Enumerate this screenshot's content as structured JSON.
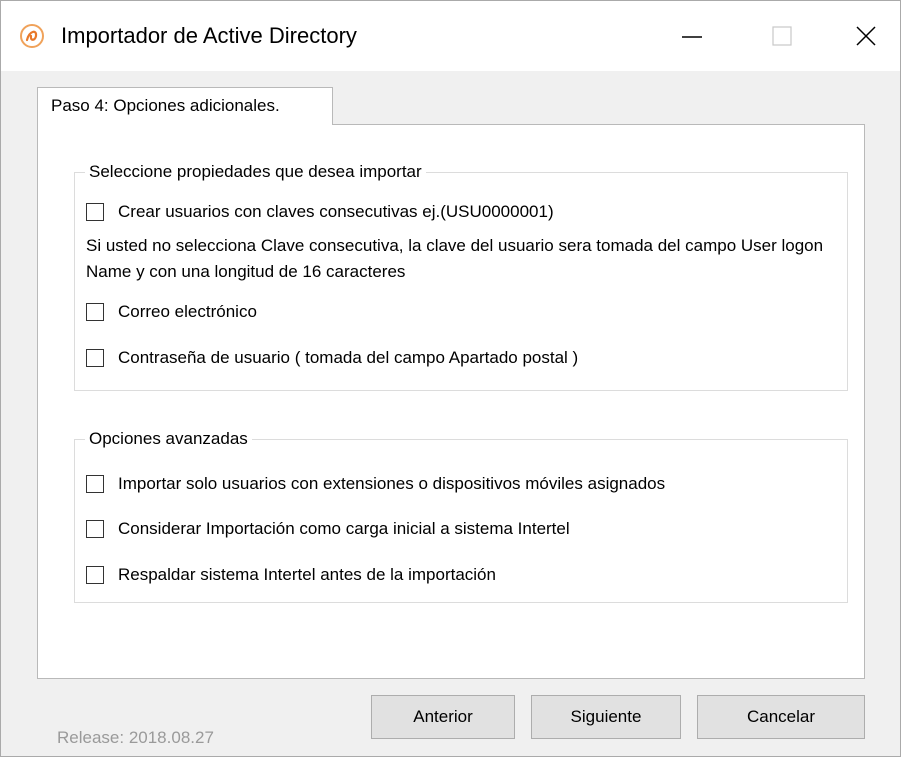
{
  "window": {
    "title": "Importador de Active Directory",
    "icon": "orange-swirl-app-icon",
    "controls": {
      "minimize_icon": "minimize-icon",
      "maximize_icon": "maximize-icon",
      "close_icon": "close-icon"
    }
  },
  "tab": {
    "label": "Paso 4: Opciones adicionales."
  },
  "group_properties": {
    "title": "Seleccione propiedades que desea importar",
    "items": [
      {
        "label": "Crear usuarios con claves consecutivas ej.(USU0000001)",
        "checked": false
      },
      {
        "label": "Correo electrónico",
        "checked": false
      },
      {
        "label": "Contraseña de usuario ( tomada del campo Apartado postal )",
        "checked": false
      }
    ],
    "note": "Si usted no selecciona Clave consecutiva, la clave del usuario sera tomada del campo User logon Name y con una longitud de 16 caracteres"
  },
  "group_advanced": {
    "title": "Opciones avanzadas",
    "items": [
      {
        "label": "Importar solo usuarios con extensiones o dispositivos móviles asignados",
        "checked": false
      },
      {
        "label": "Considerar Importación como carga inicial a sistema Intertel",
        "checked": false
      },
      {
        "label": "Respaldar sistema Intertel antes de la importación",
        "checked": false
      }
    ]
  },
  "footer": {
    "release": "Release: 2018.08.27",
    "prev_label": "Anterior",
    "next_label": "Siguiente",
    "cancel_label": "Cancelar"
  }
}
